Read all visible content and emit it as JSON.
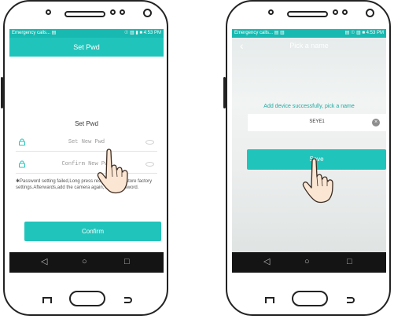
{
  "colors": {
    "accent": "#20c4bb",
    "status_bar": "#18b9b0",
    "nav_bar": "#141414"
  },
  "phone1": {
    "status": {
      "left": "Emergency calls... ▤",
      "right": "☉ ▥ ▮ ■ 4:53 PM"
    },
    "header_title": "Set Pwd",
    "section_title": "Set Pwd",
    "new_pwd_placeholder": "Set New Pwd",
    "confirm_placeholder": "Confirm New Pwd",
    "note": "✱Password setting failed,Long press reset button, restore factory settings.Afterwards,add the camera again, reset password.",
    "confirm_button": "Confirm",
    "nav": {
      "back": "◁",
      "home": "○",
      "recent": "□"
    }
  },
  "phone2": {
    "status": {
      "left": "Emergency calls... ▤ ▥",
      "right": "▤ ☉ ▥ ■ 4:53 PM"
    },
    "back_label": "‹",
    "header_title": "Pick a name",
    "prompt": "Add device successfully, pick a name",
    "name_value": "SEYE1",
    "save_button": "Save",
    "nav": {
      "back": "◁",
      "home": "○",
      "recent": "□"
    }
  }
}
